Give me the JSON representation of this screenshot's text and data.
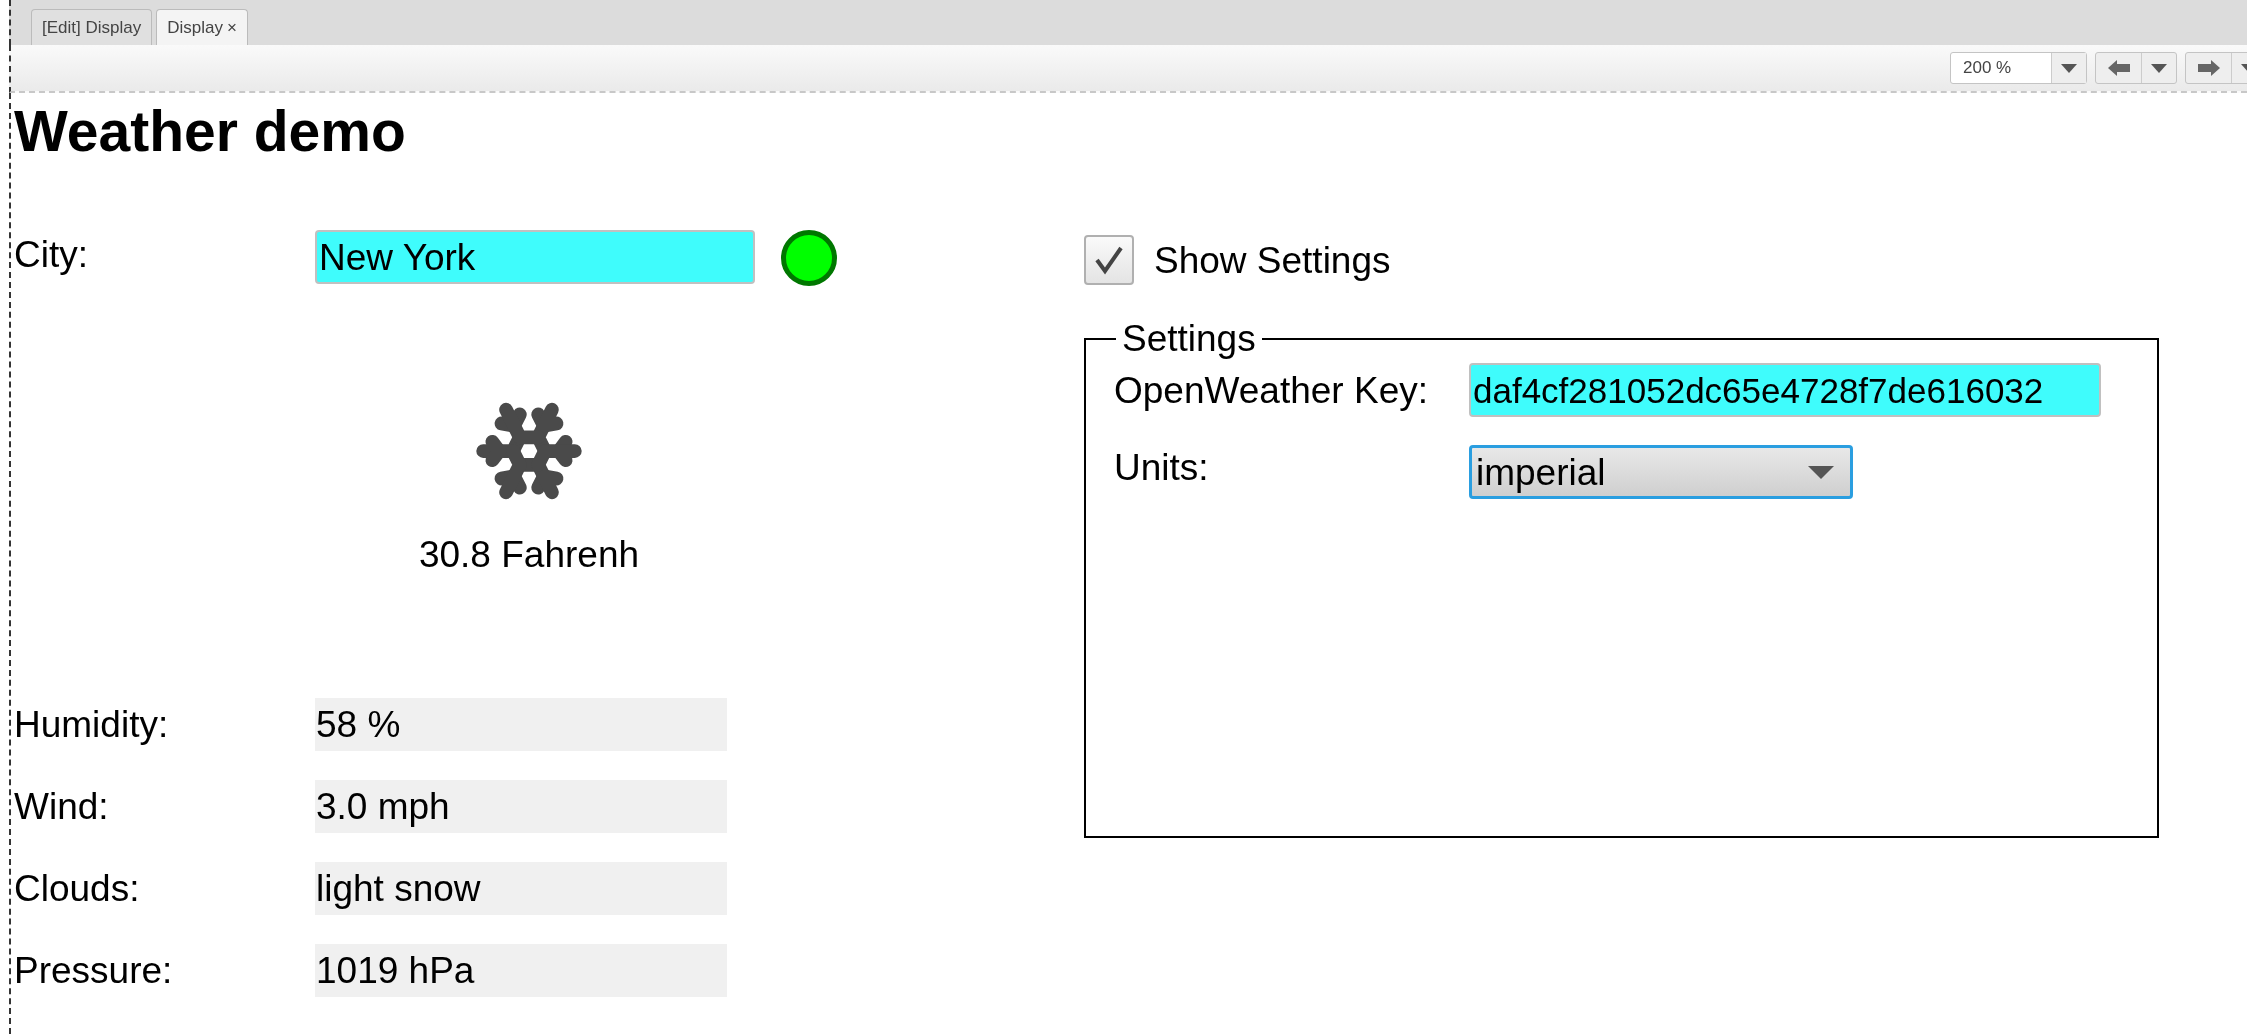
{
  "tabs": [
    {
      "label": "[Edit] Display",
      "selected": false
    },
    {
      "label": "Display",
      "selected": true,
      "close": "×"
    }
  ],
  "toolbar": {
    "zoom": "200 %"
  },
  "title": "Weather demo",
  "city": {
    "label": "City:",
    "value": "New York",
    "status_ok": true
  },
  "temperature": "30.8 Fahrenh",
  "readings": [
    {
      "label": "Humidity:",
      "value": "58 %"
    },
    {
      "label": "Wind:",
      "value": "3.0 mph"
    },
    {
      "label": "Clouds:",
      "value": "light snow"
    },
    {
      "label": "Pressure:",
      "value": "1019 hPa"
    }
  ],
  "show_settings": {
    "label": "Show Settings",
    "checked": true
  },
  "settings": {
    "title": "Settings",
    "key_label": "OpenWeather Key:",
    "key_value": "daf4cf281052dc65e4728f7de616032",
    "units_label": "Units:",
    "units_value": "imperial",
    "units_focused": true
  }
}
